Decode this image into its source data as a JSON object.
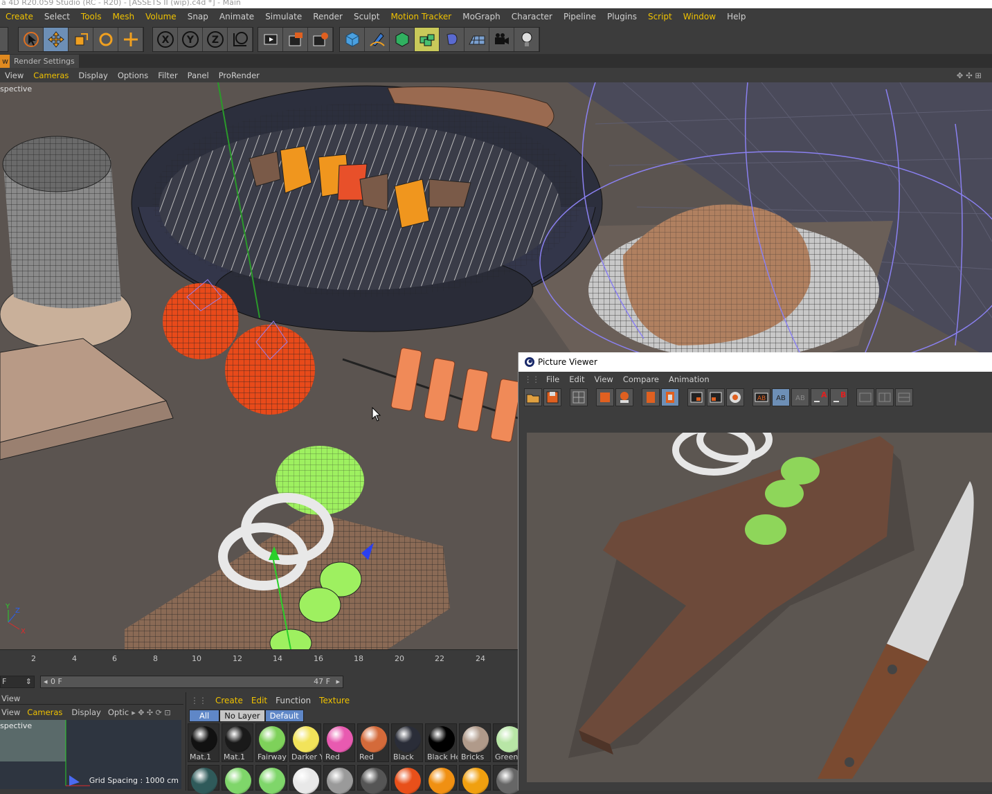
{
  "window": {
    "title": "a 4D R20.059 Studio (RC - R20) - [ASSETS II (wip).c4d *] - Main"
  },
  "menubar": {
    "items": [
      "Create",
      "Select",
      "Tools",
      "Mesh",
      "Volume",
      "Snap",
      "Animate",
      "Simulate",
      "Render",
      "Sculpt",
      "Motion Tracker",
      "MoGraph",
      "Character",
      "Pipeline",
      "Plugins",
      "Script",
      "Window",
      "Help"
    ]
  },
  "toolbar": {
    "icons": [
      "live-selection-icon",
      "move-icon",
      "scale-icon",
      "rotate-icon",
      "transform-icon",
      "x-axis-icon",
      "y-axis-icon",
      "z-axis-icon",
      "world-coordinates-icon",
      "render-view-icon",
      "render-picture-viewer-icon",
      "render-settings-icon",
      "cube-icon",
      "pen-icon",
      "subdivision-icon",
      "array-icon",
      "deformer-icon",
      "floor-icon",
      "camera-icon",
      "light-icon"
    ]
  },
  "tabs": {
    "view": "w",
    "render_settings": "Render Settings"
  },
  "viewport": {
    "menu": [
      "View",
      "Cameras",
      "Display",
      "Options",
      "Filter",
      "Panel",
      "ProRender"
    ],
    "label": "spective"
  },
  "timeline": {
    "ticks": [
      "2",
      "4",
      "6",
      "8",
      "10",
      "12",
      "14",
      "16",
      "18",
      "20",
      "22",
      "24"
    ],
    "frame_field": "F",
    "start": "0 F",
    "end": "47 F"
  },
  "small_view": {
    "title": "View",
    "menu": [
      "View",
      "Cameras",
      "Display",
      "Optic"
    ],
    "label": "spective",
    "grid_spacing": "Grid Spacing : 1000 cm"
  },
  "material_manager": {
    "menu": [
      "Create",
      "Edit",
      "Function",
      "Texture"
    ],
    "filters": [
      "All",
      "No Layer",
      "Default"
    ],
    "materials": [
      {
        "name": "Mat.1",
        "color": "#111111"
      },
      {
        "name": "Mat.1",
        "color": "#1a1a1a"
      },
      {
        "name": "Fairway",
        "color": "#7ed15a"
      },
      {
        "name": "Darker Y",
        "color": "#f2e35a"
      },
      {
        "name": "Red",
        "color": "#e85ab0"
      },
      {
        "name": "Red",
        "color": "#d46a3a"
      },
      {
        "name": "Black",
        "color": "#2a2d38"
      },
      {
        "name": "Black Ho",
        "color": "#000000"
      },
      {
        "name": "Bricks",
        "color": "#b09a8a"
      },
      {
        "name": "Green",
        "color": "#b8e6a6"
      }
    ],
    "second_row_colors": [
      "#2f5a5a",
      "#7fd66a",
      "#7fd66a",
      "#e8e8e8",
      "#9a9a9a",
      "#555555",
      "#e8501a",
      "#f09012",
      "#f0a010",
      "#666666"
    ]
  },
  "picture_viewer": {
    "title": "Picture Viewer",
    "menu": [
      "File",
      "Edit",
      "View",
      "Compare",
      "Animation"
    ]
  }
}
